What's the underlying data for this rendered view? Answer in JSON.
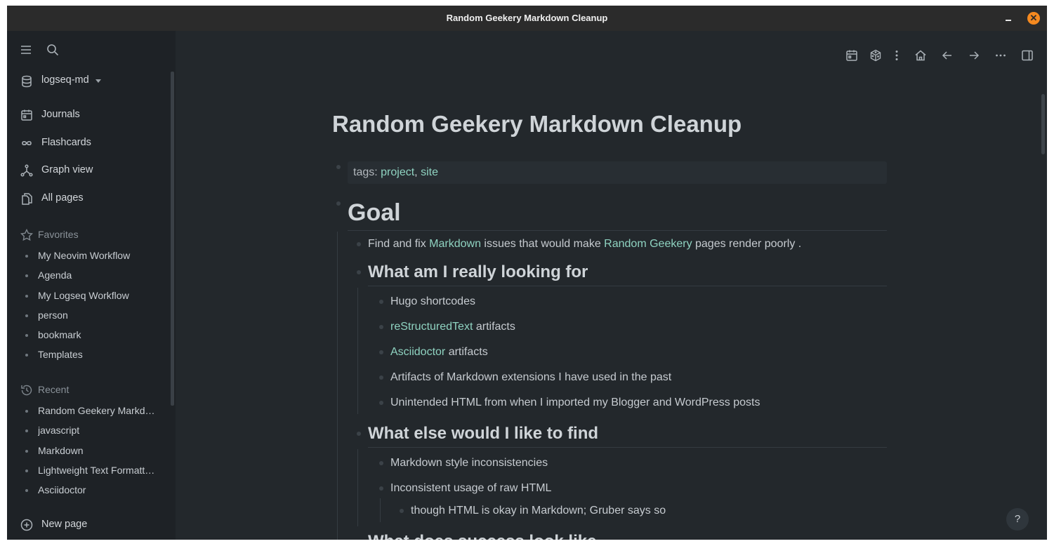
{
  "window": {
    "title": "Random Geekery Markdown Cleanup",
    "close_glyph": "✕"
  },
  "sidebar": {
    "graph_name": "logseq-md",
    "nav": [
      {
        "label": "Journals",
        "icon": "calendar-icon"
      },
      {
        "label": "Flashcards",
        "icon": "infinity-icon"
      },
      {
        "label": "Graph view",
        "icon": "graph-icon"
      },
      {
        "label": "All pages",
        "icon": "pages-icon"
      }
    ],
    "favorites_label": "Favorites",
    "favorites": [
      "My Neovim Workflow",
      "Agenda",
      "My Logseq Workflow",
      "person",
      "bookmark",
      "Templates"
    ],
    "recent_label": "Recent",
    "recent": [
      "Random Geekery Markdown Cleanup",
      "javascript",
      "Markdown",
      "Lightweight Text Formatting",
      "Asciidoctor"
    ],
    "new_page_label": "New page"
  },
  "page": {
    "title": "Random Geekery Markdown Cleanup",
    "tags_key": "tags:",
    "tags": [
      "project",
      "site"
    ],
    "goal_heading": "Goal",
    "goal_text": {
      "pre": "Find and fix ",
      "link1": "Markdown",
      "mid": " issues that would make ",
      "link2": "Random Geekery",
      "post": " pages render poorly ."
    },
    "looking_heading": "What am I really looking for",
    "looking_items": {
      "hugo": "Hugo shortcodes",
      "rst_link": "reStructuredText",
      "rst_post": " artifacts",
      "adoc_link": "Asciidoctor",
      "adoc_post": " artifacts",
      "ext": "Artifacts of Markdown extensions I have used in the past",
      "html": "Unintended HTML from when I imported my Blogger and WordPress posts"
    },
    "else_heading": "What else would I like to find",
    "else_items": {
      "style": "Markdown style inconsistencies",
      "raw": "Inconsistent usage of raw HTML",
      "gruber": "though HTML is okay in Markdown; Gruber says so"
    },
    "success_heading": "What does success look like"
  },
  "help_label": "?"
}
